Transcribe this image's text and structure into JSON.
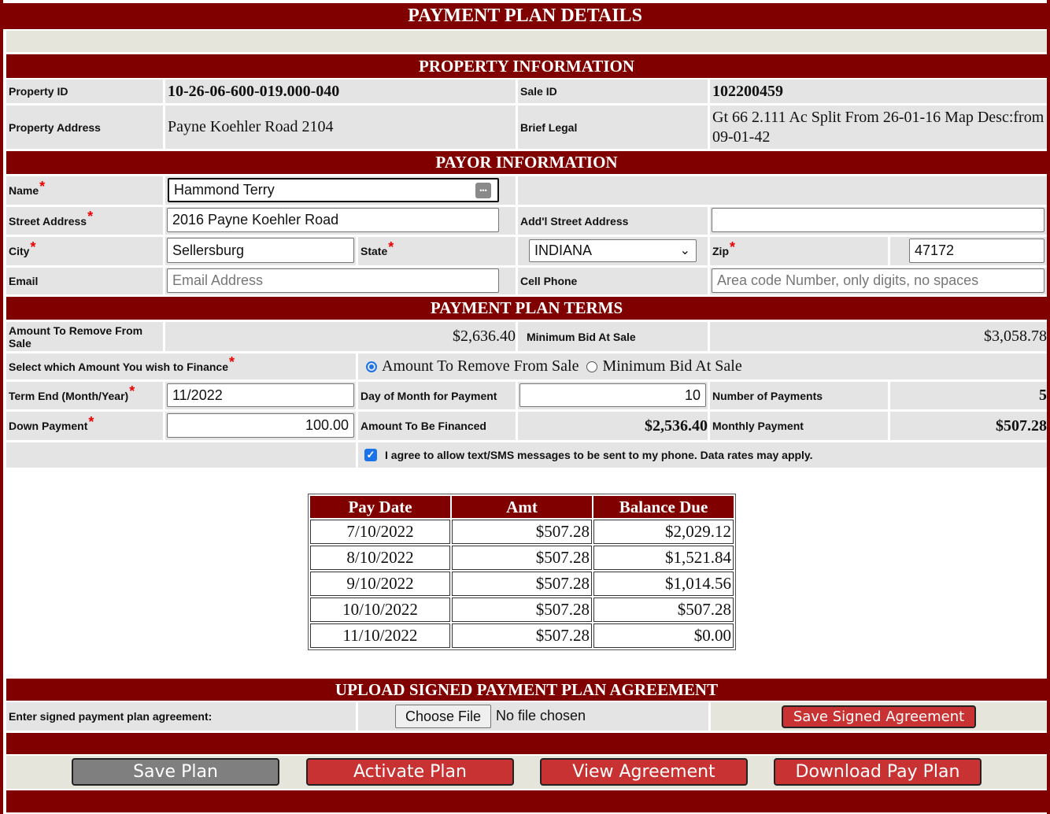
{
  "title": "PAYMENT PLAN DETAILS",
  "property": {
    "header": "PROPERTY INFORMATION",
    "id_label": "Property ID",
    "id_value": "10-26-06-600-019.000-040",
    "sale_id_label": "Sale ID",
    "sale_id_value": "102200459",
    "address_label": "Property Address",
    "address_value": "Payne Koehler Road 2104",
    "legal_label": "Brief Legal",
    "legal_value": "Gt 66 2.111 Ac Split From 26-01-16 Map Desc:from 09-01-42"
  },
  "payor": {
    "header": "PAYOR INFORMATION",
    "name_label": "Name",
    "name_value": "Hammond Terry",
    "street_label": "Street Address",
    "street_value": "2016 Payne Koehler Road",
    "addl_label": "Add'l Street Address",
    "addl_value": "",
    "city_label": "City",
    "city_value": "Sellersburg",
    "state_label": "State",
    "state_value": "INDIANA",
    "zip_label": "Zip",
    "zip_value": "47172",
    "email_label": "Email",
    "email_placeholder": "Email Address",
    "phone_label": "Cell Phone",
    "phone_placeholder": "Area code Number, only digits, no spaces",
    "required_mark": "*"
  },
  "terms": {
    "header": "PAYMENT PLAN TERMS",
    "remove_label": "Amount To Remove From Sale",
    "remove_value": "$2,636.40",
    "minbid_label": "Minimum Bid At Sale",
    "minbid_value": "$3,058.78",
    "finance_label": "Select which Amount You wish to Finance",
    "option_remove": "Amount To Remove From Sale",
    "option_minbid": "Minimum Bid At Sale",
    "term_label": "Term End (Month/Year)",
    "term_value": "11/2022",
    "day_label": "Day of Month for Payment",
    "day_value": "10",
    "numpay_label": "Number of Payments",
    "numpay_value": "5",
    "down_label": "Down Payment",
    "down_value": "100.00",
    "financed_label": "Amount To Be Financed",
    "financed_value": "$2,536.40",
    "monthly_label": "Monthly Payment",
    "monthly_value": "$507.28",
    "sms_text": "I agree to allow text/SMS messages to be sent to my phone. Data rates may apply."
  },
  "schedule": {
    "headers": [
      "Pay Date",
      "Amt",
      "Balance Due"
    ],
    "rows": [
      [
        "7/10/2022",
        "$507.28",
        "$2,029.12"
      ],
      [
        "8/10/2022",
        "$507.28",
        "$1,521.84"
      ],
      [
        "9/10/2022",
        "$507.28",
        "$1,014.56"
      ],
      [
        "10/10/2022",
        "$507.28",
        "$507.28"
      ],
      [
        "11/10/2022",
        "$507.28",
        "$0.00"
      ]
    ]
  },
  "upload": {
    "header": "UPLOAD SIGNED PAYMENT PLAN AGREEMENT",
    "label": "Enter signed payment plan agreement:",
    "choose_label": "Choose File",
    "no_file": "No file chosen",
    "save_signed": "Save Signed Agreement"
  },
  "buttons": {
    "save_plan": "Save Plan",
    "activate": "Activate Plan",
    "view": "View Agreement",
    "download": "Download Pay Plan"
  },
  "colors": {
    "header": "#800000",
    "button": "#c83232",
    "disabled_button": "#7f7f7f",
    "cell": "#e4e4e4"
  }
}
